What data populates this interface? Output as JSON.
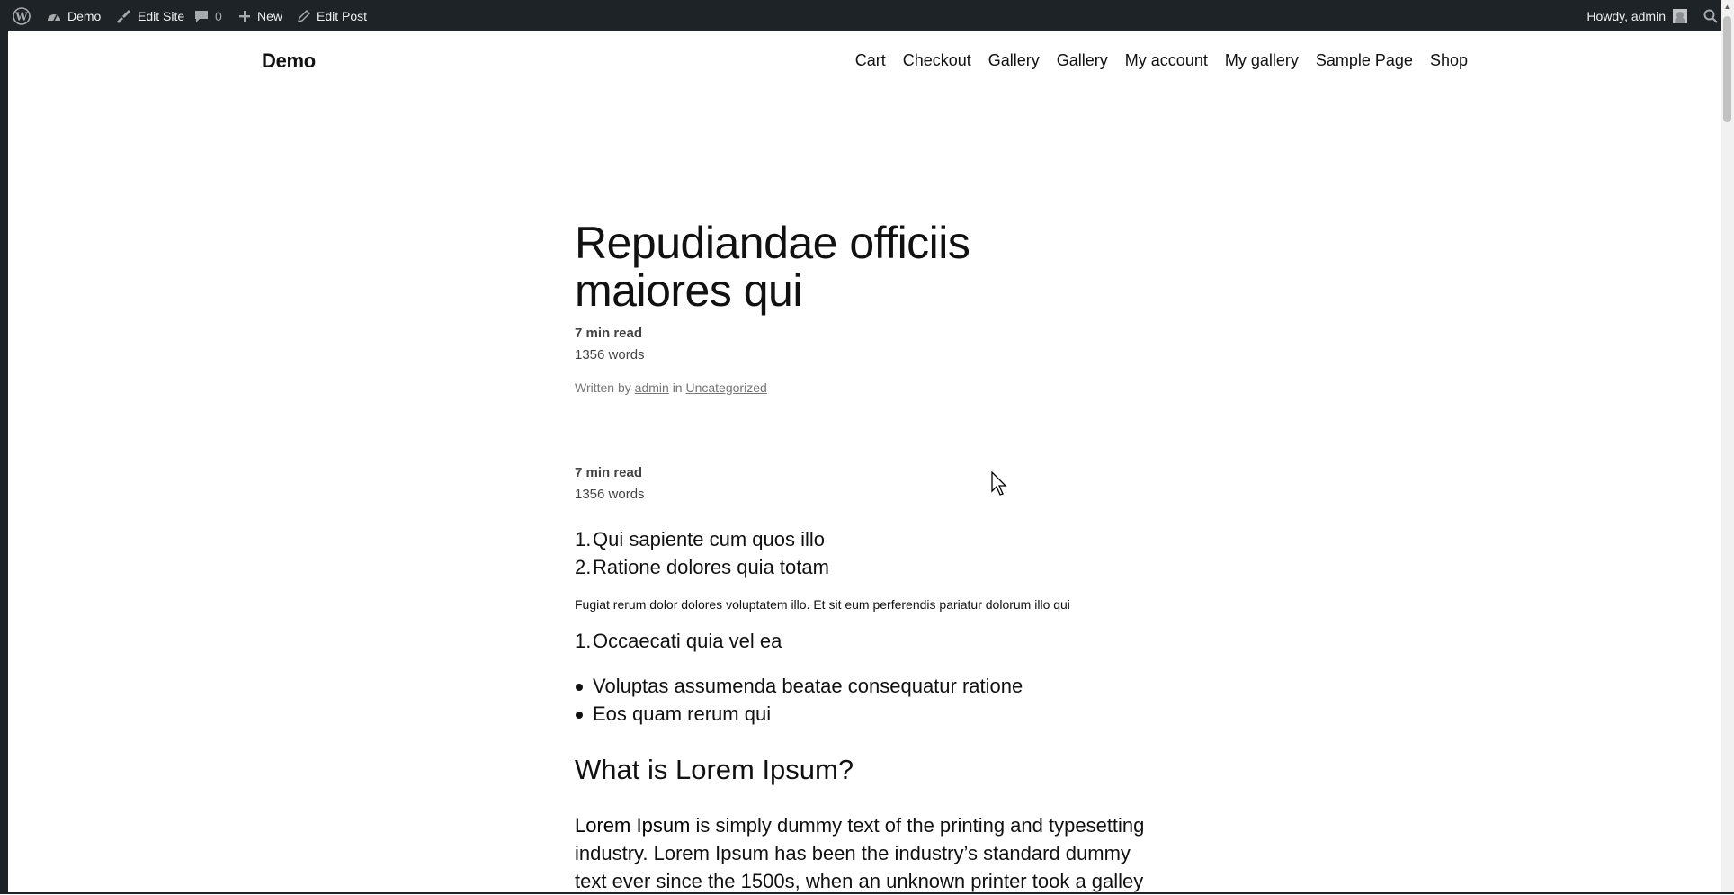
{
  "adminbar": {
    "site_name": "Demo",
    "edit_site": "Edit Site",
    "comments_count": "0",
    "new_label": "New",
    "edit_post": "Edit Post",
    "howdy": "Howdy, admin"
  },
  "header": {
    "site_title": "Demo",
    "nav": [
      "Cart",
      "Checkout",
      "Gallery",
      "Gallery",
      "My account",
      "My gallery",
      "Sample Page",
      "Shop"
    ]
  },
  "post": {
    "title": "Repudiandae officiis maiores qui",
    "read_time": "7 min read",
    "word_count": "1356 words",
    "byline_prefix": "Written by",
    "author": "admin",
    "byline_in": "in",
    "category": "Uncategorized",
    "read_time_2": "7 min read",
    "word_count_2": "1356 words",
    "list1": [
      {
        "num": "1.",
        "text": "Qui sapiente cum quos illo"
      },
      {
        "num": "2.",
        "text": "Ratione dolores quia totam"
      }
    ],
    "small_paragraph": "Fugiat rerum dolor dolores voluptatem illo. Et sit eum perferendis pariatur dolorum illo qui",
    "list2": [
      {
        "num": "1.",
        "text": "Occaecati quia vel ea"
      }
    ],
    "bullets": [
      "Voluptas assumenda beatae consequatur ratione",
      "Eos quam rerum qui"
    ],
    "heading": "What is Lorem Ipsum?",
    "para_strong": "Lorem Ipsum",
    "para_rest": " is simply dummy text of the printing and typesetting industry. Lorem Ipsum has been the industry’s standard dummy text ever since the 1500s, when an unknown printer took a galley"
  }
}
